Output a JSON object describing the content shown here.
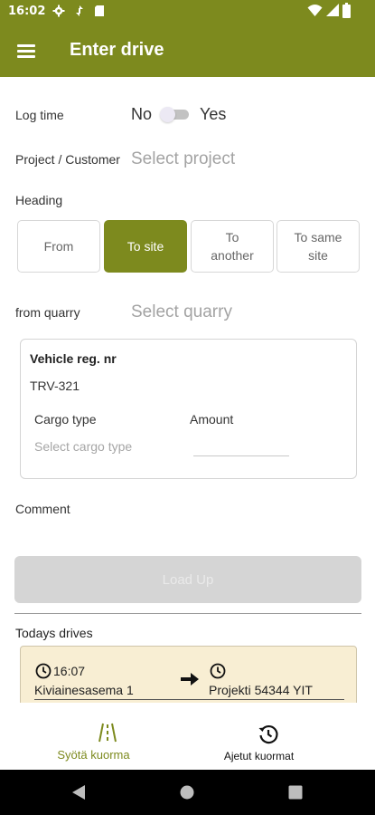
{
  "status_bar": {
    "time": "16:02",
    "icons": [
      "settings-icon",
      "vpn-icon",
      "sd-card-icon",
      "wifi-icon",
      "signal-icon",
      "battery-icon"
    ]
  },
  "app_bar": {
    "title": "Enter drive",
    "menu_icon": "hamburger-menu-icon"
  },
  "form": {
    "log_time": {
      "label": "Log time",
      "no": "No",
      "yes": "Yes",
      "on": false
    },
    "project": {
      "label": "Project / Customer",
      "placeholder": "Select project"
    },
    "heading": {
      "label": "Heading",
      "options": [
        "From",
        "To site",
        "To\nanother",
        "To same\nsite"
      ],
      "selected": "To site"
    },
    "quarry": {
      "label": "from quarry",
      "placeholder": "Select quarry"
    },
    "vehicle": {
      "label": "Vehicle reg. nr",
      "value": "TRV-321",
      "cargo_label": "Cargo type",
      "cargo_placeholder": "Select cargo type",
      "amount_label": "Amount",
      "amount_value": ""
    },
    "comment": {
      "label": "Comment"
    },
    "load_button": "Load Up"
  },
  "todays": {
    "label": "Todays drives",
    "drives": [
      {
        "time": "16:07",
        "from": "Kiviainesasema 1",
        "to": "Projekti 54344 YIT",
        "time_to": ""
      }
    ]
  },
  "bottom_nav": {
    "items": [
      {
        "label": "Syötä kuorma",
        "icon": "road-icon",
        "active": true
      },
      {
        "label": "Ajetut kuormat",
        "icon": "history-icon",
        "active": false
      }
    ]
  },
  "colors": {
    "primary": "#7d8a1e",
    "drive_card_bg": "#f8eed3",
    "disabled_button": "#d5d5d5",
    "placeholder": "#a3a3a3"
  }
}
